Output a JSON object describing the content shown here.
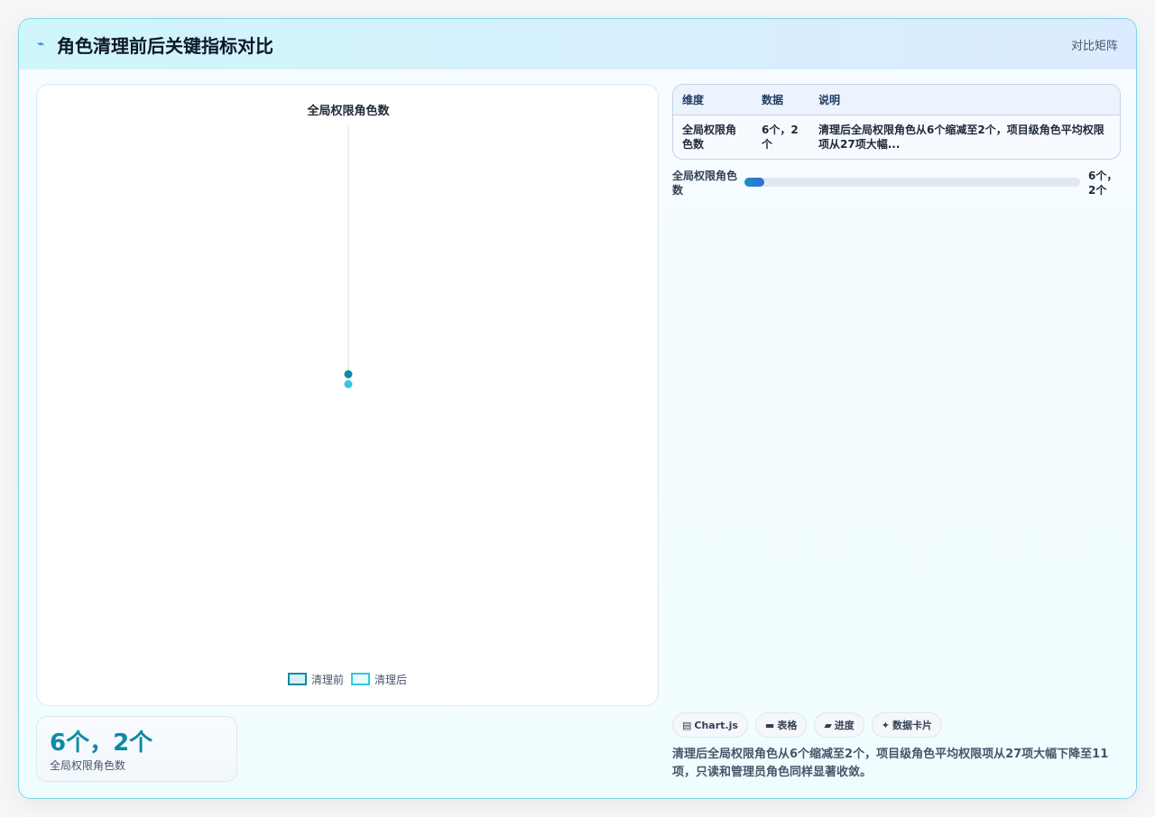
{
  "header": {
    "title": "角色清理前后关键指标对比",
    "right_label": "对比矩阵",
    "icon": "wave-icon"
  },
  "chart_data": {
    "type": "scatter",
    "title": "全局权限角色数",
    "categories": [
      "全局权限角色数"
    ],
    "series": [
      {
        "name": "清理前",
        "values": [
          6
        ],
        "color": "#0e8aa5"
      },
      {
        "name": "清理后",
        "values": [
          2
        ],
        "color": "#35c6e0"
      }
    ],
    "legend_position": "bottom",
    "grid": false
  },
  "stat": {
    "value": "6个，2个",
    "label": "全局权限角色数"
  },
  "table": {
    "headers": [
      "维度",
      "数据",
      "说明"
    ],
    "rows": [
      {
        "dimension": "全局权限角色数",
        "data": "6个，2个",
        "desc": "清理后全局权限角色从6个缩减至2个，项目级角色平均权限项从27项大幅..."
      }
    ]
  },
  "progress": {
    "label": "全局权限角色数",
    "value_text": "6个，2个",
    "fraction": 0.06
  },
  "chips": [
    {
      "icon": "chart-icon",
      "glyph": "▤",
      "label": "Chart.js"
    },
    {
      "icon": "table-icon",
      "glyph": "▬",
      "label": "表格"
    },
    {
      "icon": "progress-icon",
      "glyph": "▰",
      "label": "进度"
    },
    {
      "icon": "sparkle-icon",
      "glyph": "✦",
      "label": "数据卡片"
    }
  ],
  "summary": "清理后全局权限角色从6个缩减至2个，项目级角色平均权限项从27项大幅下降至11项，只读和管理员角色同样显著收敛。"
}
